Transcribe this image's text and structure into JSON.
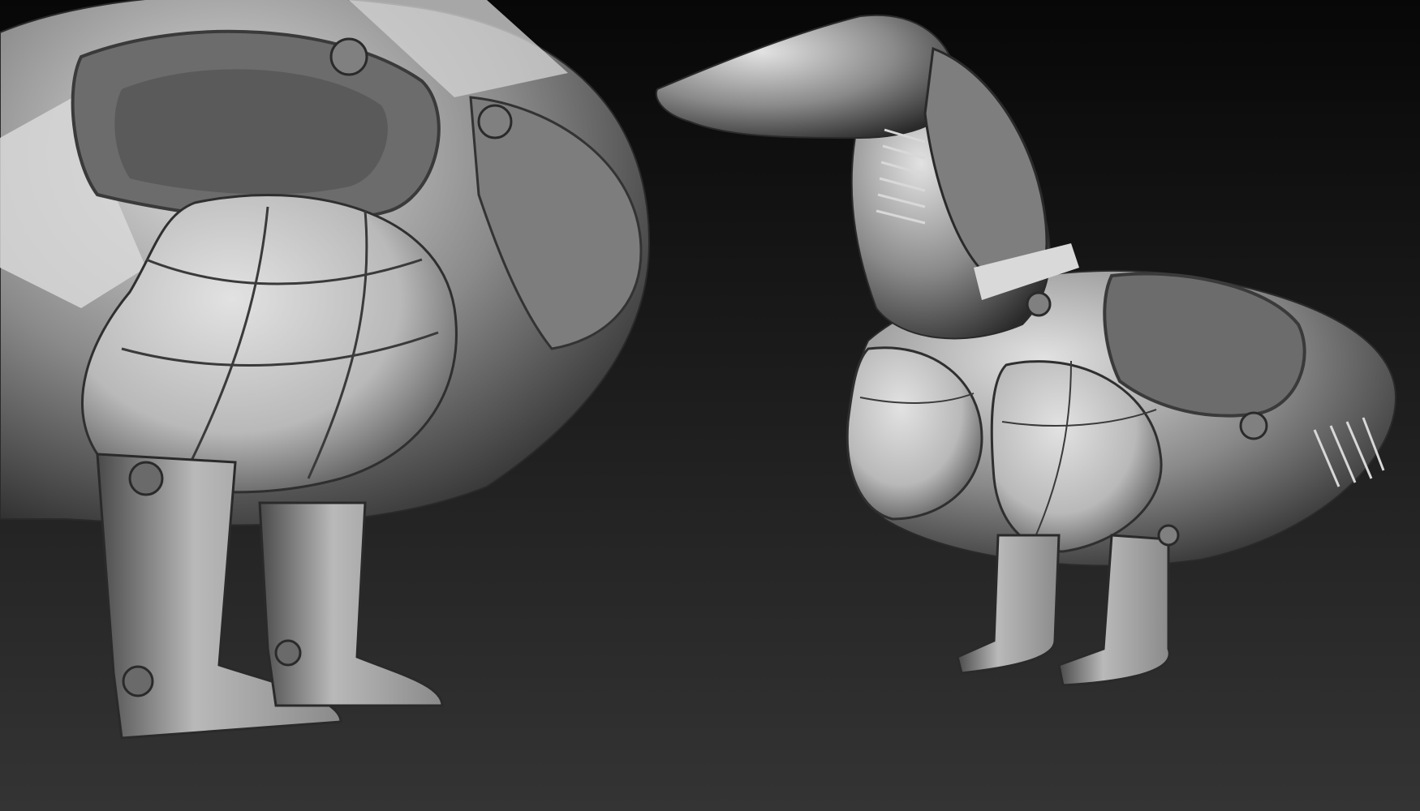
{
  "viewport": {
    "background_top": "#070707",
    "background_bottom": "#343434",
    "clay_light": "#b9b9b9",
    "clay_mid": "#8a8a8a",
    "clay_dark": "#4a4a4a",
    "clay_shadow": "#2a2a2a",
    "highlight": "#e2e2e2"
  },
  "models": [
    {
      "name": "closeup-view",
      "subject": "dachshund-in-spacesuit-closeup"
    },
    {
      "name": "full-view",
      "subject": "dachshund-in-spacesuit-full"
    }
  ]
}
